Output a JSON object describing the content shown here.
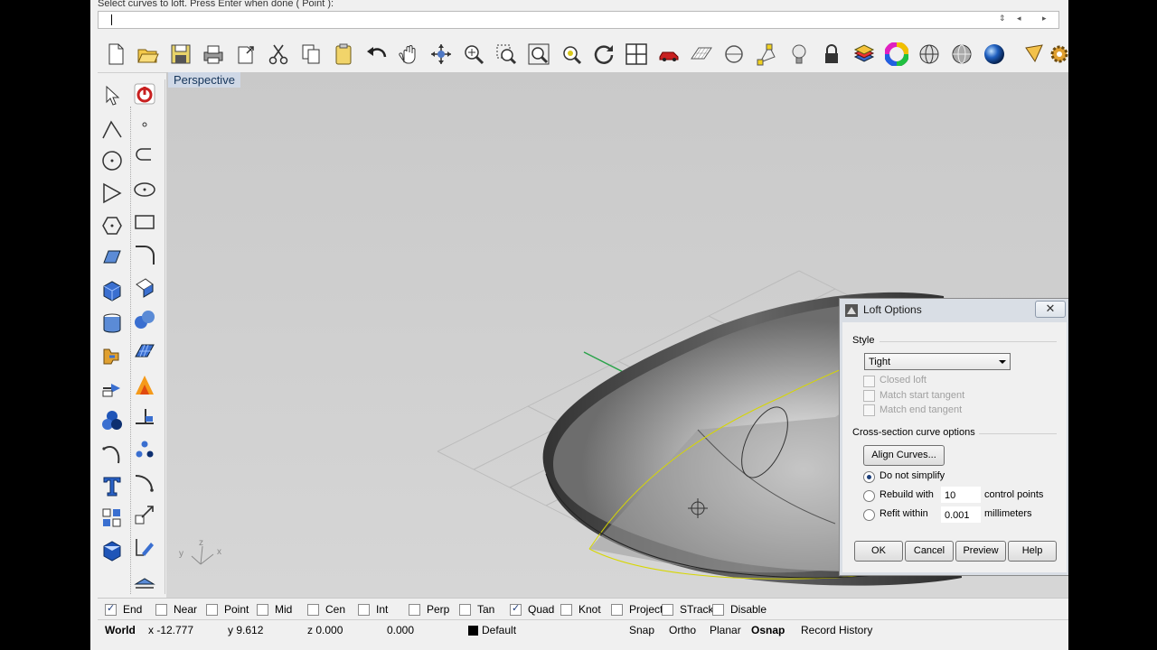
{
  "command": {
    "previous_prompt": "Select curves to loft. Press Enter when done ( Point ):",
    "input_value": ""
  },
  "toolbar": {
    "icons": [
      "new-icon",
      "open-icon",
      "save-icon",
      "print-icon",
      "import-icon",
      "cut-icon",
      "copy-icon",
      "paste-icon",
      "undo-icon",
      "pan-hand-icon",
      "rotate-view-icon",
      "zoom-icon",
      "zoom-window-icon",
      "zoom-extents-icon",
      "zoom-selected-icon",
      "refresh-icon",
      "four-viewports-icon",
      "car-icon",
      "grid-icon",
      "osnap-icon",
      "point-icon",
      "light-bulb-icon",
      "lock-icon",
      "layer-icon",
      "color-wheel-icon",
      "wireframe-sphere-icon",
      "shaded-sphere-icon",
      "rendered-sphere-icon",
      "pencil-icon",
      "options-gear-icon"
    ]
  },
  "left_tools": {
    "icons": [
      "select-arrow-icon",
      "power-icon",
      "polyline-icon",
      "point-icon",
      "circle-icon",
      "arc-icon",
      "curve-icon",
      "ellipse-icon",
      "polygon-icon",
      "rectangle-icon",
      "surface-icon",
      "fillet-curve-icon",
      "box-icon",
      "extrude-surface-icon",
      "cylinder-icon",
      "spheres-icon",
      "explode-icon",
      "patch-surface-icon",
      "transform-icon",
      "boolean-icon",
      "solids-icon",
      "analyze-icon",
      "arc-tool-icon",
      "dots-icon",
      "text-icon",
      "curve-fillet-icon",
      "array-icon",
      "move-icon",
      "render-box-icon",
      "mirror-icon",
      "dimension-icon"
    ]
  },
  "viewport": {
    "title": "Perspective",
    "axis_labels": {
      "x": "x",
      "y": "y",
      "z": "z"
    }
  },
  "dialog": {
    "title": "Loft Options",
    "close_label": "✕",
    "style_label": "Style",
    "style_value": "Tight",
    "closed_loft": "Closed loft",
    "match_start": "Match start tangent",
    "match_end": "Match end tangent",
    "cross_section_label": "Cross-section curve options",
    "align_button": "Align Curves...",
    "do_not_simplify": "Do not simplify",
    "rebuild_with": "Rebuild with",
    "rebuild_value": "10",
    "rebuild_unit": "control points",
    "refit_within": "Refit within",
    "refit_value": "0.001",
    "refit_unit": "millimeters",
    "selected_option": "Do not simplify",
    "ok": "OK",
    "cancel": "Cancel",
    "preview": "Preview",
    "help": "Help"
  },
  "osnap": [
    {
      "label": "End",
      "checked": true
    },
    {
      "label": "Near",
      "checked": false
    },
    {
      "label": "Point",
      "checked": false
    },
    {
      "label": "Mid",
      "checked": false
    },
    {
      "label": "Cen",
      "checked": false
    },
    {
      "label": "Int",
      "checked": false
    },
    {
      "label": "Perp",
      "checked": false
    },
    {
      "label": "Tan",
      "checked": false
    },
    {
      "label": "Quad",
      "checked": true
    },
    {
      "label": "Knot",
      "checked": false
    },
    {
      "label": "Project",
      "checked": false
    },
    {
      "label": "STrack",
      "checked": false
    },
    {
      "label": "Disable",
      "checked": false
    }
  ],
  "status": {
    "cplane": "World",
    "x": "x -12.777",
    "y": "y 9.612",
    "z": "z 0.000",
    "extra": "0.000",
    "layer": "Default",
    "snap": "Snap",
    "ortho": "Ortho",
    "planar": "Planar",
    "osnap": "Osnap",
    "record_history": "Record History"
  }
}
